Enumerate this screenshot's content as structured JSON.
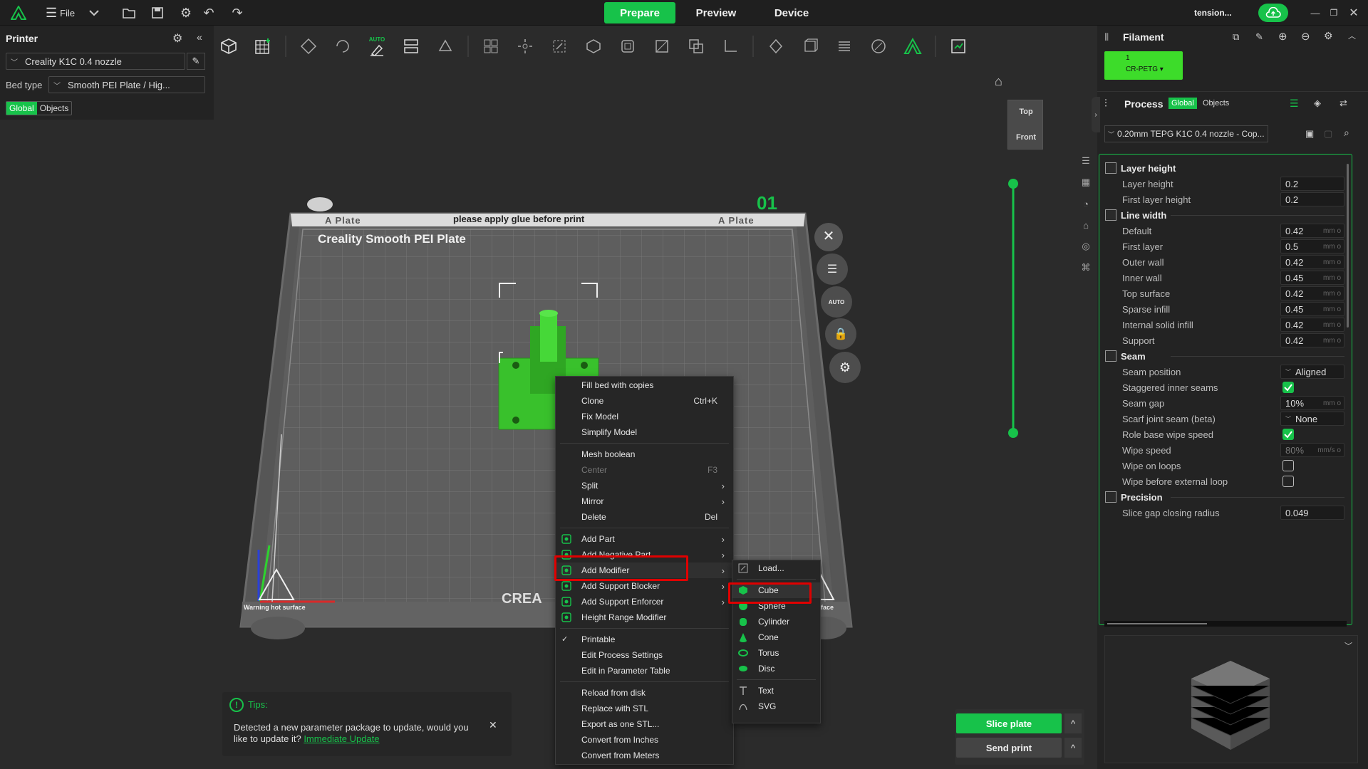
{
  "topbar": {
    "file_label": "File",
    "tabs": [
      {
        "label": "Prepare",
        "active": true
      },
      {
        "label": "Preview",
        "active": false
      },
      {
        "label": "Device",
        "active": false
      }
    ],
    "user": "tension...",
    "accent": "#17c24a"
  },
  "printer": {
    "title": "Printer",
    "selected": "Creality K1C 0.4 nozzle",
    "bed_type_label": "Bed type",
    "bed_type_value": "Smooth PEI Plate / Hig...",
    "scope_tabs": [
      "Global",
      "Objects"
    ]
  },
  "plate": {
    "left_label": "A Plate",
    "center_label": "please apply glue before print",
    "right_label": "A Plate",
    "bed_name": "Creality Smooth PEI Plate",
    "plate_number": "01",
    "warning": "Warning hot surface",
    "brand_partial": "CREA",
    "brand_right_partial": "face"
  },
  "view_cube": {
    "top": "Top",
    "front": "Front"
  },
  "context_menu": {
    "items": [
      {
        "label": "Fill bed with copies",
        "shortcut": "",
        "submenu": false
      },
      {
        "label": "Clone",
        "shortcut": "Ctrl+K",
        "submenu": false
      },
      {
        "label": "Fix Model",
        "shortcut": "",
        "submenu": false
      },
      {
        "label": "Simplify Model",
        "shortcut": "",
        "submenu": false
      },
      {
        "sep": true
      },
      {
        "label": "Mesh boolean",
        "shortcut": "",
        "submenu": false
      },
      {
        "label": "Center",
        "shortcut": "F3",
        "submenu": false,
        "disabled": true
      },
      {
        "label": "Split",
        "shortcut": "",
        "submenu": true
      },
      {
        "label": "Mirror",
        "shortcut": "",
        "submenu": true
      },
      {
        "label": "Delete",
        "shortcut": "Del",
        "submenu": false
      },
      {
        "sep": true
      },
      {
        "label": "Add Part",
        "shortcut": "",
        "submenu": true,
        "icon": "add-part-icon"
      },
      {
        "label": "Add Negative Part",
        "shortcut": "",
        "submenu": true,
        "icon": "add-negative-part-icon"
      },
      {
        "label": "Add Modifier",
        "shortcut": "",
        "submenu": true,
        "icon": "add-modifier-icon",
        "highlight": true
      },
      {
        "label": "Add Support Blocker",
        "shortcut": "",
        "submenu": true,
        "icon": "support-blocker-icon"
      },
      {
        "label": "Add Support Enforcer",
        "shortcut": "",
        "submenu": true,
        "icon": "support-enforcer-icon"
      },
      {
        "label": "Height Range Modifier",
        "shortcut": "",
        "submenu": false,
        "icon": "height-range-icon"
      },
      {
        "sep": true
      },
      {
        "label": "Printable",
        "shortcut": "",
        "submenu": false,
        "checked": true
      },
      {
        "label": "Edit Process Settings",
        "shortcut": "",
        "submenu": false
      },
      {
        "label": "Edit in Parameter Table",
        "shortcut": "",
        "submenu": false
      },
      {
        "sep": true
      },
      {
        "label": "Reload from disk",
        "shortcut": "",
        "submenu": false
      },
      {
        "label": "Replace with STL",
        "shortcut": "",
        "submenu": false
      },
      {
        "label": "Export as one STL...",
        "shortcut": "",
        "submenu": false
      },
      {
        "label": "Convert from Inches",
        "shortcut": "",
        "submenu": false
      },
      {
        "label": "Convert from Meters",
        "shortcut": "",
        "submenu": false
      }
    ]
  },
  "submenu": {
    "items": [
      {
        "label": "Load...",
        "icon": "load-icon"
      },
      {
        "sep": true
      },
      {
        "label": "Cube",
        "icon": "cube-icon",
        "highlight": true
      },
      {
        "label": "Sphere",
        "icon": "sphere-icon"
      },
      {
        "label": "Cylinder",
        "icon": "cylinder-icon"
      },
      {
        "label": "Cone",
        "icon": "cone-icon"
      },
      {
        "label": "Torus",
        "icon": "torus-icon"
      },
      {
        "label": "Disc",
        "icon": "disc-icon"
      },
      {
        "sep": true
      },
      {
        "label": "Text",
        "icon": "text-icon"
      },
      {
        "label": "SVG",
        "icon": "svg-icon"
      }
    ]
  },
  "tips": {
    "title": "Tips:",
    "text": "Detected a new parameter package to update, would you like to update it?",
    "link": "Immediate Update"
  },
  "slice": {
    "slice_label": "Slice plate",
    "send_label": "Send print",
    "caret": "^"
  },
  "filament": {
    "title": "Filament",
    "slot_number": "1",
    "slot_name": "CR-PETG ▾",
    "slot_color": "#3ddc2a"
  },
  "process": {
    "title": "Process",
    "tabs": [
      "Global",
      "Objects"
    ],
    "preset": "0.20mm TEPG K1C 0.4 nozzle - Cop...",
    "sections": [
      {
        "title": "Layer height",
        "rows": [
          {
            "label": "Layer height",
            "value": "0.2",
            "unit": ""
          },
          {
            "label": "First layer height",
            "value": "0.2",
            "unit": ""
          }
        ]
      },
      {
        "title": "Line width",
        "rows": [
          {
            "label": "Default",
            "value": "0.42",
            "unit": "mm o"
          },
          {
            "label": "First layer",
            "value": "0.5",
            "unit": "mm o"
          },
          {
            "label": "Outer wall",
            "value": "0.42",
            "unit": "mm o"
          },
          {
            "label": "Inner wall",
            "value": "0.45",
            "unit": "mm o"
          },
          {
            "label": "Top surface",
            "value": "0.42",
            "unit": "mm o"
          },
          {
            "label": "Sparse infill",
            "value": "0.45",
            "unit": "mm o"
          },
          {
            "label": "Internal solid infill",
            "value": "0.42",
            "unit": "mm o"
          },
          {
            "label": "Support",
            "value": "0.42",
            "unit": "mm o"
          }
        ]
      },
      {
        "title": "Seam",
        "rows": [
          {
            "label": "Seam position",
            "value": "Aligned",
            "type": "select"
          },
          {
            "label": "Staggered inner seams",
            "value": true,
            "type": "check"
          },
          {
            "label": "Seam gap",
            "value": "10%",
            "unit": "mm o"
          },
          {
            "label": "Scarf joint seam (beta)",
            "value": "None",
            "type": "select"
          },
          {
            "label": "Role base wipe speed",
            "value": true,
            "type": "check"
          },
          {
            "label": "Wipe speed",
            "value": "80%",
            "unit": "mm/s o",
            "dim": true
          },
          {
            "label": "Wipe on loops",
            "value": false,
            "type": "check"
          },
          {
            "label": "Wipe before external loop",
            "value": false,
            "type": "check"
          }
        ]
      },
      {
        "title": "Precision",
        "rows": [
          {
            "label": "Slice gap closing radius",
            "value": "0.049",
            "unit": "",
            "partial": true
          }
        ]
      }
    ]
  }
}
